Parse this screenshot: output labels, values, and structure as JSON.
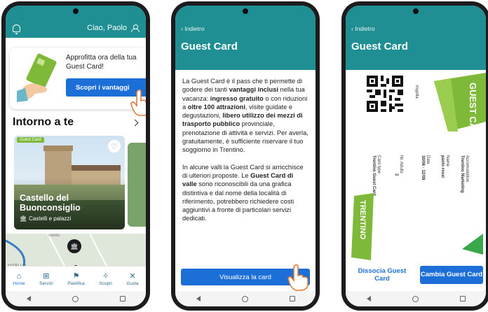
{
  "phone1": {
    "greeting": "Ciao, Paolo",
    "promo": {
      "text": "Approfitta ora della tua Guest Card!",
      "button": "Scopri i vantaggi"
    },
    "section_title": "Intorno a te",
    "card": {
      "badge": "Guest Card",
      "title_line1": "Castello del",
      "title_line2": "Buonconsiglio",
      "category": "Castelli e palazzi"
    },
    "map_label": "ASTELLO",
    "map_label2": "Trento",
    "tabs": [
      {
        "label": "Home",
        "icon": "home-icon"
      },
      {
        "label": "Servizi",
        "icon": "grid-icon"
      },
      {
        "label": "Pianifica",
        "icon": "signpost-icon"
      },
      {
        "label": "Scopri",
        "icon": "compass-icon"
      },
      {
        "label": "Gusta",
        "icon": "cutlery-icon"
      }
    ]
  },
  "phone2": {
    "back": "Indietro",
    "title": "Guest Card",
    "cta": "Visualizza la card"
  },
  "phone3": {
    "back": "Indietro",
    "title": "Guest Card",
    "card": {
      "brand": "GUEST CARD",
      "logo": "TRENTINO",
      "field_mypillab": "mypilla",
      "acc_label": "Accomodation",
      "acc_value": "Trentino Marketing",
      "name_label": "Name",
      "name_value": "paolo rossi",
      "date_label": "Date",
      "date_value": "30/06 - 12/09",
      "adults_label": "Nr. Adults",
      "adults_value": "2",
      "card_label": "Card type",
      "card_value": "Trentino Guest Card"
    },
    "dissocia": "Dissocia Guest Card",
    "cambia": "Cambia Guest Card"
  },
  "colors": {
    "teal": "#1f8f93",
    "blue": "#1d6fd8",
    "green": "#7fb93a"
  }
}
